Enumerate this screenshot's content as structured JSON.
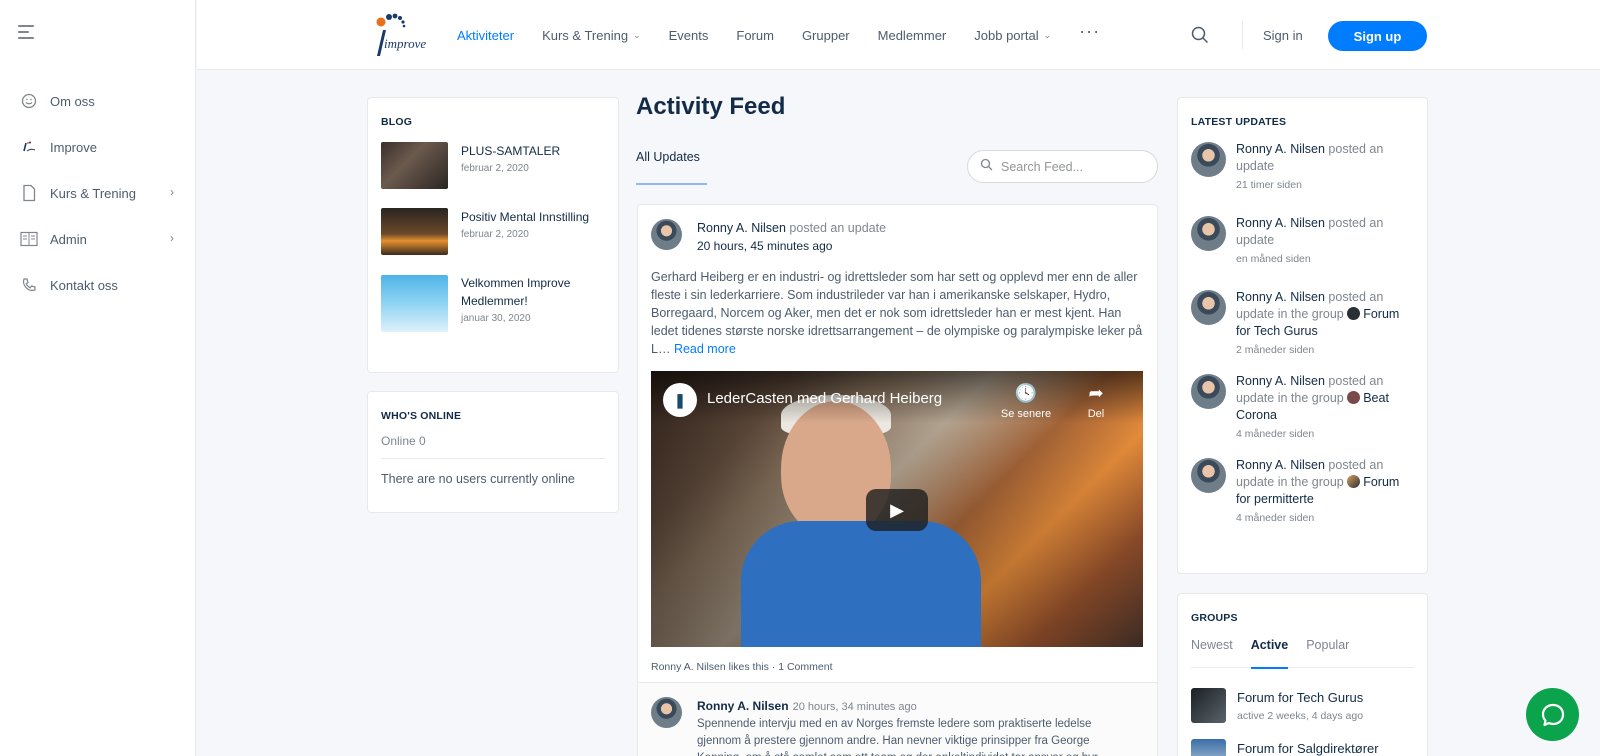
{
  "sidebar": {
    "items": [
      {
        "label": "Om oss",
        "icon": "smile-icon"
      },
      {
        "label": "Improve",
        "icon": "improve-logo-icon"
      },
      {
        "label": "Kurs & Trening",
        "icon": "document-icon"
      },
      {
        "label": "Admin",
        "icon": "list-icon"
      },
      {
        "label": "Kontakt oss",
        "icon": "phone-icon"
      }
    ]
  },
  "header": {
    "logo_text": "improve",
    "nav": [
      {
        "label": "Aktiviteter"
      },
      {
        "label": "Kurs & Trening"
      },
      {
        "label": "Events"
      },
      {
        "label": "Forum"
      },
      {
        "label": "Grupper"
      },
      {
        "label": "Medlemmer"
      },
      {
        "label": "Jobb portal"
      }
    ],
    "more": "···",
    "signin": "Sign in",
    "signup": "Sign up",
    "accent": "#007cff"
  },
  "blog": {
    "title": "BLOG",
    "posts": [
      {
        "title": "PLUS-SAMTALER",
        "date": "februar 2, 2020"
      },
      {
        "title": "Positiv Mental Innstilling",
        "date": "februar 2, 2020"
      },
      {
        "title": "Velkommen Improve Medlemmer!",
        "date": "januar 30, 2020"
      }
    ]
  },
  "online": {
    "title": "WHO'S ONLINE",
    "count": "Online 0",
    "empty": "There are no users currently online"
  },
  "feed": {
    "title": "Activity Feed",
    "tab": "All Updates",
    "search_placeholder": "Search Feed...",
    "post": {
      "author": "Ronny A. Nilsen",
      "action": "posted an update",
      "time": "20 hours, 45 minutes ago",
      "body": "Gerhard Heiberg er en industri- og idrettsleder som har sett og opplevd mer enn de aller fleste i sin lederkarriere. Som industrileder var han i amerikanske selskaper, Hydro, Borregaard, Norcem og Aker, men det er nok som idrettsleder han er mest kjent. Han ledet tidenes største norske idrettsarrangement – de olympiske og paralympiske leker på L…",
      "read_more": "Read more",
      "video": {
        "title": "LederCasten med Gerhard Heiberg",
        "watch_later": "Se senere",
        "share": "Del"
      },
      "meta": "Ronny A. Nilsen likes this · 1 Comment",
      "comment": {
        "author": "Ronny A. Nilsen",
        "time": "20 hours, 34 minutes ago",
        "text": "Spennende intervju med en av Norges fremste ledere som praktiserte ledelse gjennom å prestere gjennom andre. Han nevner viktige prinsipper fra George Kenning, om å stå samlet som ett team og der enkeltindividet tar ansvar og byr"
      }
    }
  },
  "updates": {
    "title": "LATEST UPDATES",
    "items": [
      {
        "name": "Ronny A. Nilsen",
        "action": "posted an update",
        "group": "",
        "time": "21 timer siden"
      },
      {
        "name": "Ronny A. Nilsen",
        "action": "posted an update",
        "group": "",
        "time": "en måned siden"
      },
      {
        "name": "Ronny A. Nilsen",
        "action": "posted an update in the group",
        "group": "Forum for Tech Gurus",
        "time": "2 måneder siden"
      },
      {
        "name": "Ronny A. Nilsen",
        "action": "posted an update in the group",
        "group": "Beat Corona",
        "time": "4 måneder siden"
      },
      {
        "name": "Ronny A. Nilsen",
        "action": "posted an update in the group",
        "group": "Forum for permitterte",
        "time": "4 måneder siden"
      }
    ]
  },
  "groups": {
    "title": "GROUPS",
    "tabs": [
      "Newest",
      "Active",
      "Popular"
    ],
    "items": [
      {
        "name": "Forum for Tech Gurus",
        "sub": "active 2 weeks, 4 days ago"
      },
      {
        "name": "Forum for Salgdirektører",
        "sub": ""
      }
    ]
  }
}
